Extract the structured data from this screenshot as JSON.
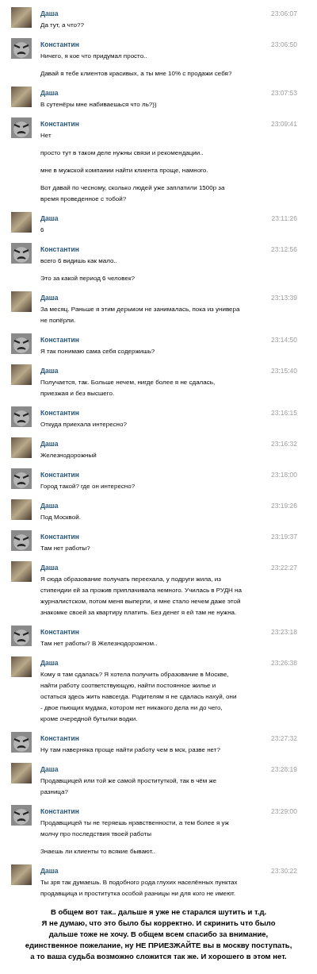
{
  "messages": [
    {
      "kind": "photo",
      "sender": "Даша",
      "time": "23:06:07",
      "paragraphs": [
        "Да тут, а что??"
      ]
    },
    {
      "kind": "cartoon",
      "sender": "Константин",
      "time": "23:06:50",
      "paragraphs": [
        "Ничего, я кое что придумал просто..",
        "Давай я тебе клиентов красивых, а ты мне 10% с продажи себя?"
      ]
    },
    {
      "kind": "photo",
      "sender": "Даша",
      "time": "23:07:53",
      "paragraphs": [
        "В сутенёры мне набиваешься что ль?))"
      ]
    },
    {
      "kind": "cartoon",
      "sender": "Константин",
      "time": "23:09:41",
      "paragraphs": [
        "Нет",
        "просто тут в таком деле нужны связи и рекомендации..",
        "мне в мужской компании найти клиента проще, намного.",
        "Вот давай по чесному, сколько людей уже заплатили 1500р за\nвремя проведенное с тобой?"
      ]
    },
    {
      "kind": "photo",
      "sender": "Даша",
      "time": "23:11:26",
      "paragraphs": [
        "6"
      ]
    },
    {
      "kind": "cartoon",
      "sender": "Константин",
      "time": "23:12:56",
      "paragraphs": [
        "всего 6 видишь как мало..",
        "Это за какой период 6 человек?"
      ]
    },
    {
      "kind": "photo",
      "sender": "Даша",
      "time": "23:13:39",
      "paragraphs": [
        "За месяц. Раньше я этим дерьмом не занималась, пока из универа\nне попёрли."
      ]
    },
    {
      "kind": "cartoon",
      "sender": "Константин",
      "time": "23:14:50",
      "paragraphs": [
        "Я так понимаю сама себя содержишь?"
      ]
    },
    {
      "kind": "photo",
      "sender": "Даша",
      "time": "23:15:40",
      "paragraphs": [
        "Получается, так. Больше нечем, нигде более я не сдалась,\nприезжая и без высшего."
      ]
    },
    {
      "kind": "cartoon",
      "sender": "Константин",
      "time": "23:16:15",
      "paragraphs": [
        "Откуда приехала интересно?"
      ]
    },
    {
      "kind": "photo",
      "sender": "Даша",
      "time": "23:16:32",
      "paragraphs": [
        "Железнодорожный"
      ]
    },
    {
      "kind": "cartoon",
      "sender": "Константин",
      "time": "23:18:00",
      "paragraphs": [
        "Город такой? где он интересно?"
      ]
    },
    {
      "kind": "photo",
      "sender": "Даша",
      "time": "23:19:26",
      "paragraphs": [
        "Под Москвой."
      ]
    },
    {
      "kind": "cartoon",
      "sender": "Константин",
      "time": "23:19:37",
      "paragraphs": [
        "Там нет работы?"
      ]
    },
    {
      "kind": "photo",
      "sender": "Даша",
      "time": "23:22:27",
      "paragraphs": [
        "Я сюда образование получать переехала, у подруги жила, из\nстипендии ей за прожив приплачивала немного. Училась в РУДН на\nжурналистском, потом меня выперли, и мне стало нечем даже этой\nзнакомке своей за квартиру платить. Без денег я ей там не нужна."
      ]
    },
    {
      "kind": "cartoon",
      "sender": "Константин",
      "time": "23:23:18",
      "paragraphs": [
        "Там нет работы? В Железнодорожном.."
      ]
    },
    {
      "kind": "photo",
      "sender": "Даша",
      "time": "23:26:38",
      "paragraphs": [
        "Кому я там сдалась? Я хотела получить образование в Москве,\nнайти работу соответствующую, найти постоянное жилье и\nостаться здесь жить навсегда. Родителям я не сдалась нахуй, они\n- двое пьющих мудака, котором нет никакого дела ни до чего,\nкроме очередной бутылки водки."
      ]
    },
    {
      "kind": "cartoon",
      "sender": "Константин",
      "time": "23:27:32",
      "paragraphs": [
        "Ну там наверняка проще найти работу чем в мск, разве нет?"
      ]
    },
    {
      "kind": "photo",
      "sender": "Даша",
      "time": "23:28:19",
      "paragraphs": [
        "Продавщицей или той же самой проституткой, так в чём же\nразница?"
      ]
    },
    {
      "kind": "cartoon",
      "sender": "Константин",
      "time": "23:29:00",
      "paragraphs": [
        "Продавщицей ты не теряешь нравственности, а тем более я уж\nмолчу про последствия твоей работы",
        "Знаешь ли клиенты то всякие бывают.."
      ]
    },
    {
      "kind": "photo",
      "sender": "Даша",
      "time": "23:30:22",
      "paragraphs": [
        "Ты зря так думаешь. В подобного рода глухих населённых пунктах\nпродавщица и проститутка особой разницы ни для кого не имеют."
      ]
    }
  ],
  "caption": "В общем вот так.. дальше я уже не старался шутить и т.д.\nЯ не думаю, что это было бы корректно. И скринить что было\nдальше тоже не хочу. В общем всем спасибо за внимание,\nединственное пожелание, ну НЕ ПРИЕЗЖАЙТЕ вы в москву поступать,\nа то ваша судьба возможно сложится так же. И хорошего в этом нет."
}
